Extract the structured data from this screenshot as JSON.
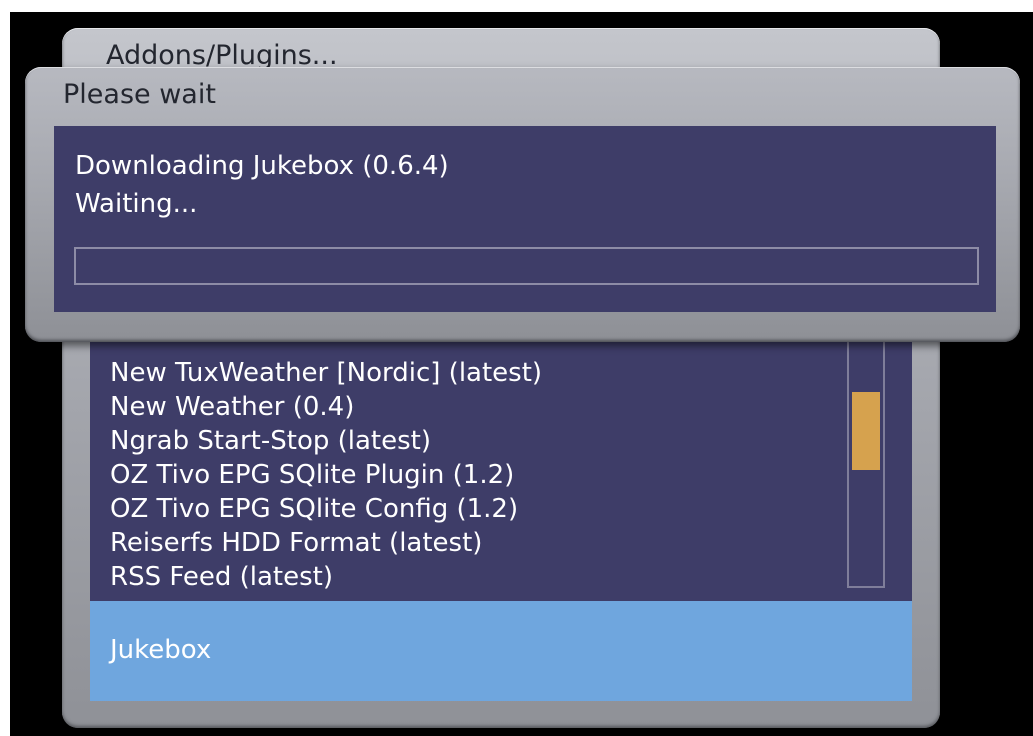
{
  "background_window": {
    "title": "Addons/Plugins...",
    "list_items": [
      "New TuxWeather [Nordic] (latest)",
      "New Weather (0.4)",
      "Ngrab Start-Stop (latest)",
      "OZ Tivo EPG SQlite Plugin (1.2)",
      "OZ Tivo EPG SQlite Config (1.2)",
      "Reiserfs HDD Format (latest)",
      "RSS Feed (latest)"
    ],
    "selected_detail": "Jukebox",
    "scroll_position": 0.3
  },
  "dialog": {
    "title": "Please wait",
    "message_line1": "Downloading Jukebox (0.6.4)",
    "message_line2": "Waiting...",
    "progress": 0
  },
  "colors": {
    "panel_bg": "#3e3d68",
    "selected_bg": "#6fa6de",
    "scroll_thumb": "#d6a24e",
    "window_chrome": "#a9abb2"
  }
}
